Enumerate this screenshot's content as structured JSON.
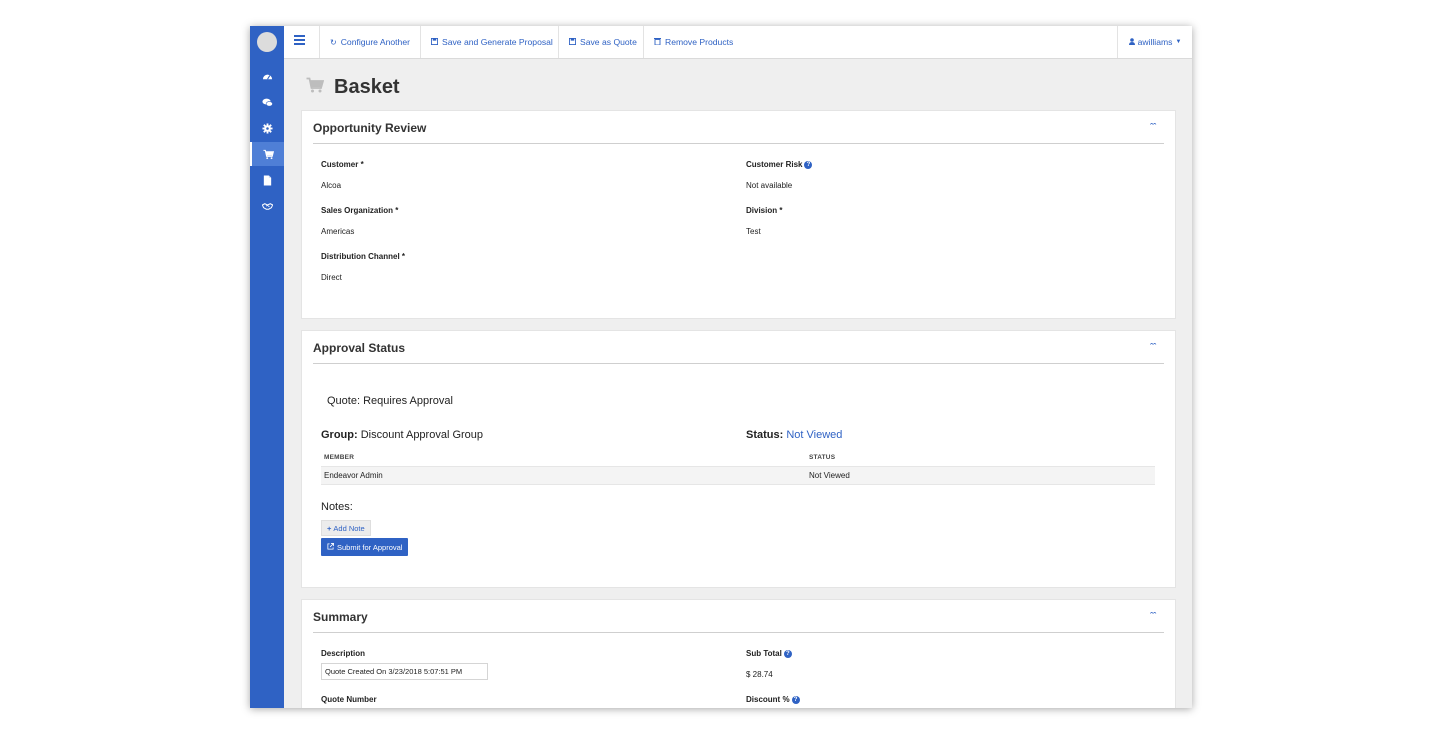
{
  "toolbar": {
    "configure_another": "Configure Another",
    "save_generate": "Save and Generate Proposal",
    "save_quote": "Save as Quote",
    "remove_products": "Remove Products",
    "user": "awilliams"
  },
  "sidebar": {
    "icons": [
      "dashboard-icon",
      "comments-icon",
      "gear-icon",
      "cart-icon",
      "document-icon",
      "handshake-icon"
    ],
    "active": "cart-icon"
  },
  "page": {
    "title": "Basket"
  },
  "opportunity": {
    "title": "Opportunity Review",
    "customer_label": "Customer *",
    "customer_value": "Alcoa",
    "risk_label": "Customer Risk",
    "risk_value": "Not available",
    "salesorg_label": "Sales Organization *",
    "salesorg_value": "Americas",
    "division_label": "Division *",
    "division_value": "Test",
    "channel_label": "Distribution Channel *",
    "channel_value": "Direct"
  },
  "approval": {
    "title": "Approval Status",
    "quote_status": "Quote: Requires Approval",
    "group_label": "Group:",
    "group_value": "Discount Approval Group",
    "status_label": "Status:",
    "status_value": "Not Viewed",
    "col_member": "MEMBER",
    "col_status": "STATUS",
    "rows": [
      {
        "member": "Endeavor Admin",
        "status": "Not Viewed"
      }
    ],
    "notes_label": "Notes:",
    "add_note": "Add Note",
    "submit": "Submit for Approval"
  },
  "summary": {
    "title": "Summary",
    "description_label": "Description",
    "description_value": "Quote Created On 3/23/2018 5:07:51 PM",
    "subtotal_label": "Sub Total",
    "subtotal_value": "$ 28.74",
    "quote_number_label": "Quote Number",
    "discount_label": "Discount %"
  },
  "colors": {
    "brand": "#2f62c4",
    "background": "#efefef"
  }
}
